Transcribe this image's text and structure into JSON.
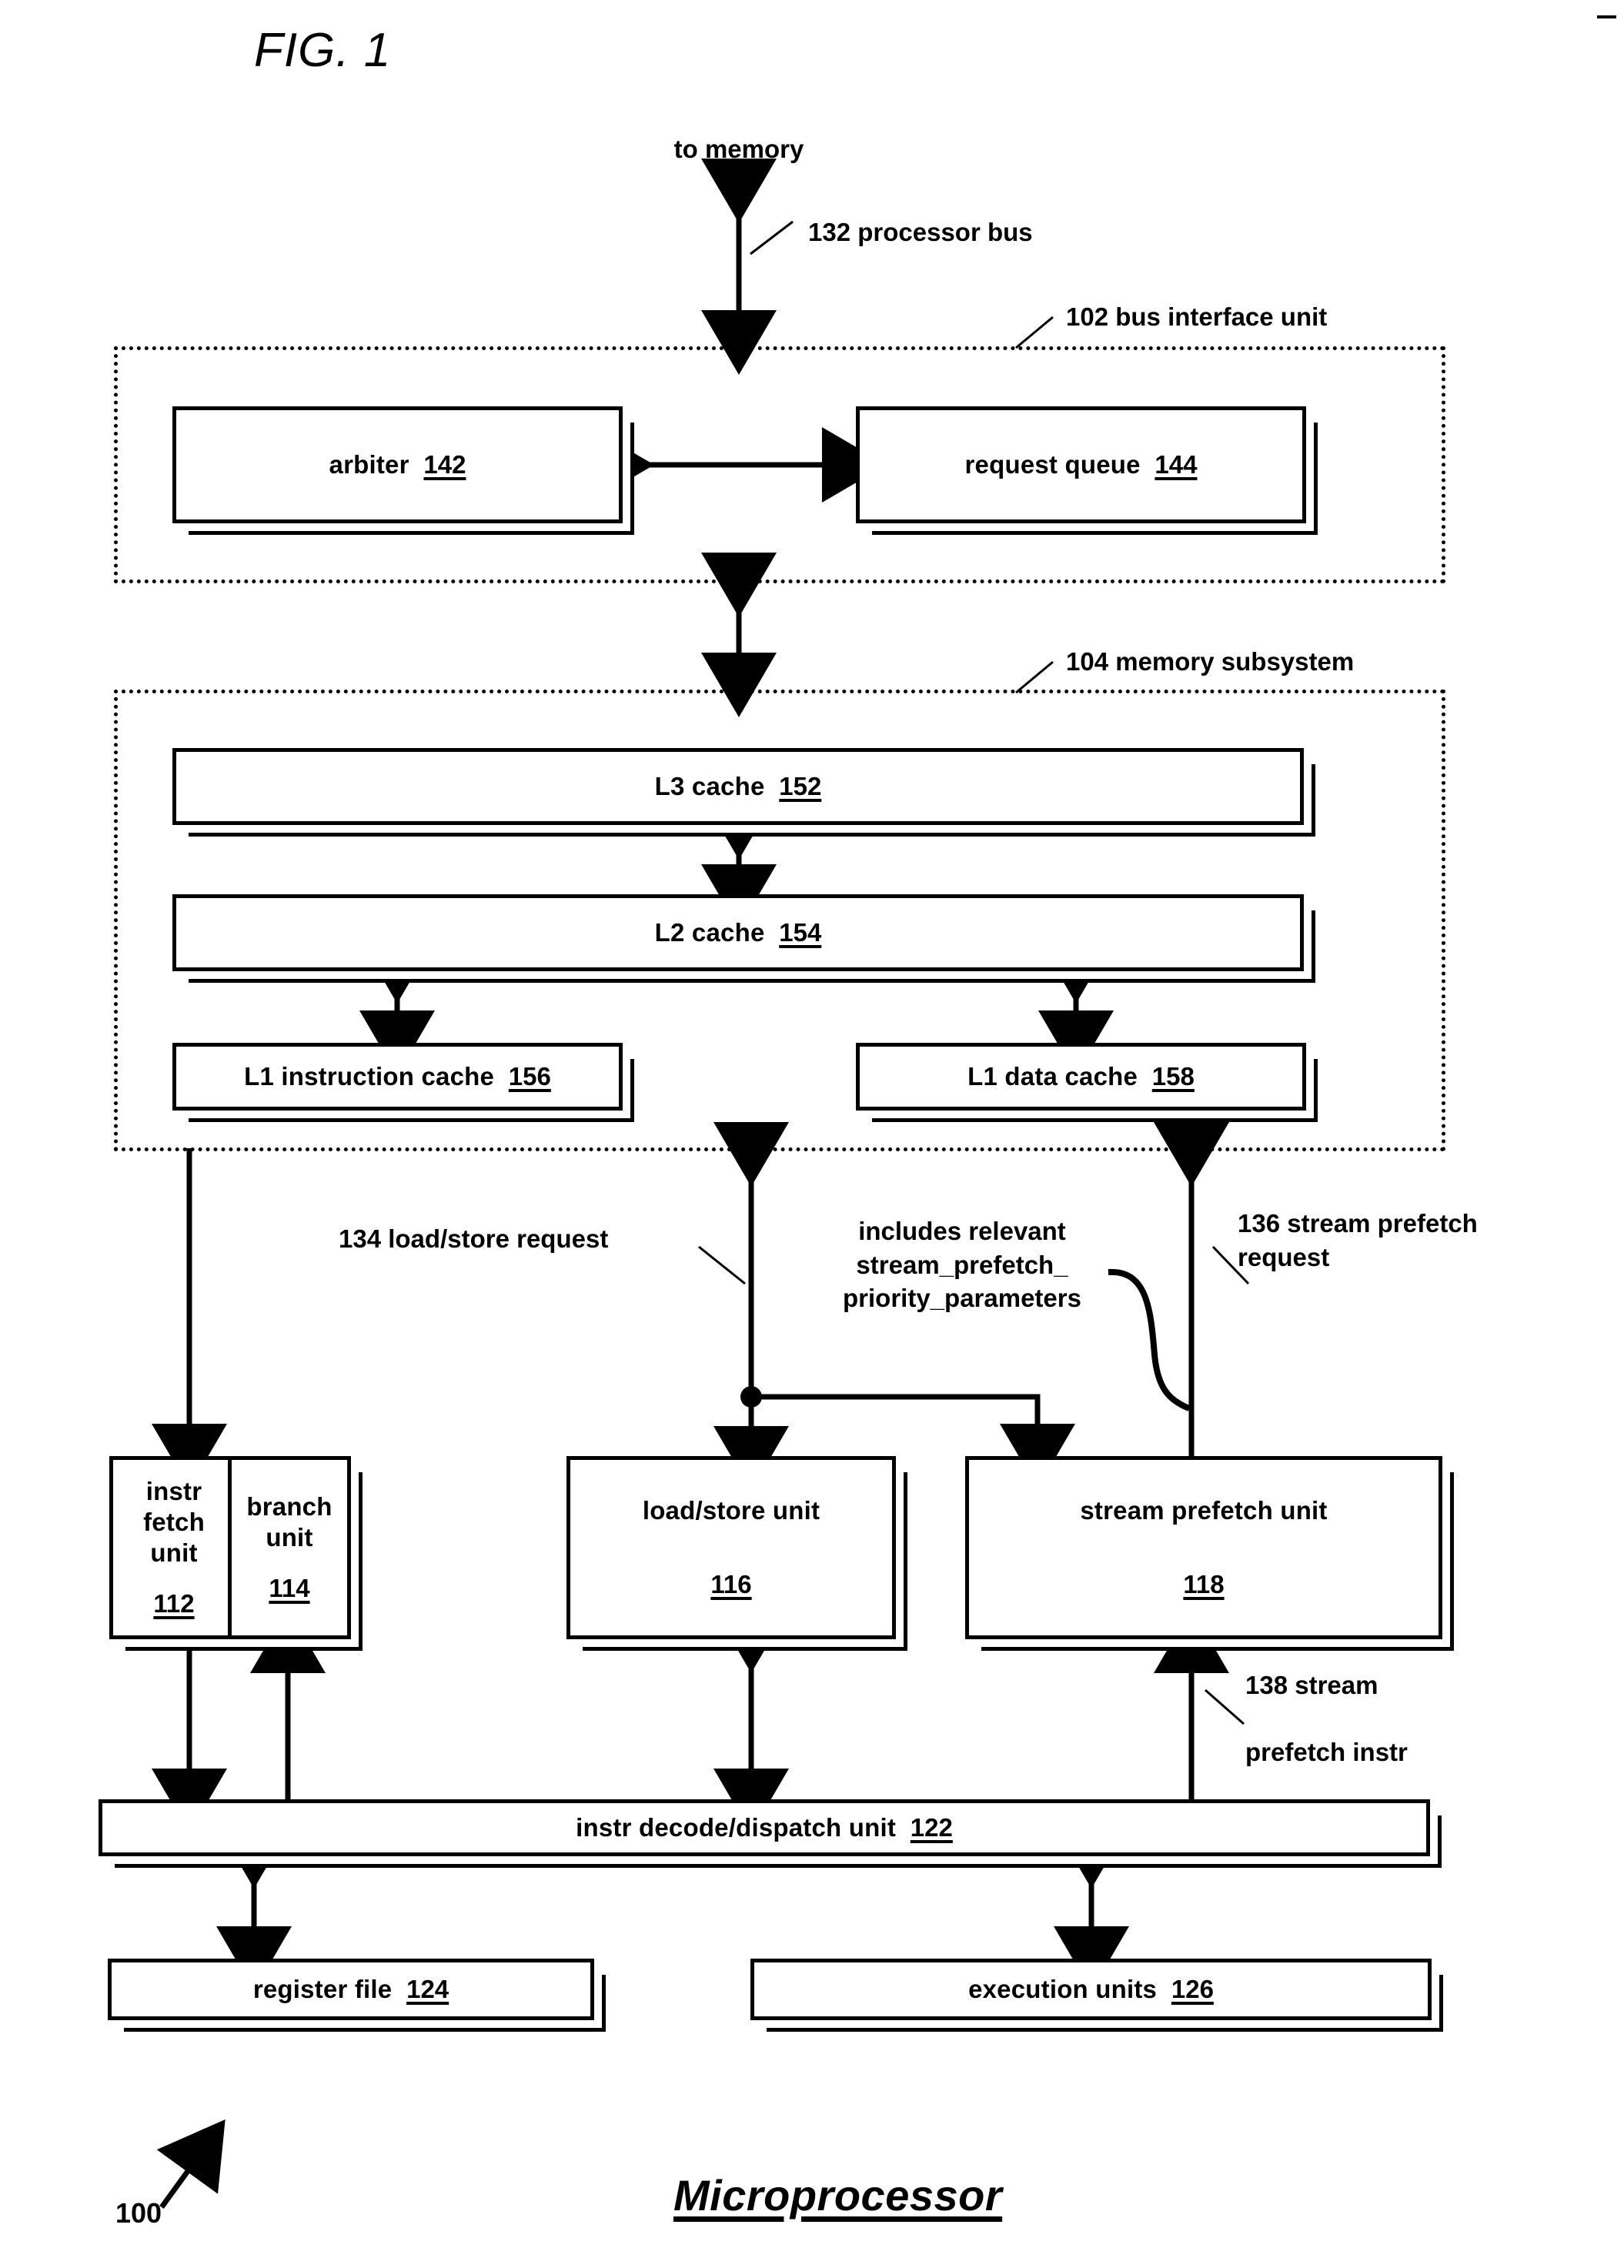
{
  "figure": {
    "label": "FIG. 1",
    "title": "Microprocessor",
    "ref_number": "100"
  },
  "top": {
    "to_memory": "to memory",
    "processor_bus": "132  processor bus"
  },
  "regions": [
    {
      "id": "bus-interface-unit",
      "label": "102  bus interface unit"
    },
    {
      "id": "memory-subsystem",
      "label": "104  memory subsystem"
    }
  ],
  "bus_interface_unit": {
    "blocks": [
      {
        "id": "arbiter",
        "label": "arbiter",
        "num": "142"
      },
      {
        "id": "request-queue",
        "label": "request queue",
        "num": "144"
      }
    ]
  },
  "memory_subsystem": {
    "blocks": [
      {
        "id": "l3-cache",
        "label": "L3 cache",
        "num": "152"
      },
      {
        "id": "l2-cache",
        "label": "L2 cache",
        "num": "154"
      },
      {
        "id": "l1-instruction-cache",
        "label": "L1 instruction cache",
        "num": "156"
      },
      {
        "id": "l1-data-cache",
        "label": "L1 data cache",
        "num": "158"
      }
    ]
  },
  "annotations": {
    "load_store_request": "134  load/store request",
    "includes_relevant": "includes relevant\nstream_prefetch_\npriority_parameters",
    "stream_prefetch_request": "136  stream prefetch\nrequest",
    "stream_prefetch_instr": "138  stream\n\nprefetch instr"
  },
  "functional_units": [
    {
      "id": "instr-fetch-unit",
      "label": "instr fetch\nunit",
      "num": "112"
    },
    {
      "id": "branch-unit",
      "label": "branch\nunit",
      "num": "114"
    },
    {
      "id": "load-store-unit",
      "label": "load/store unit",
      "num": "116"
    },
    {
      "id": "stream-prefetch-unit",
      "label": "stream prefetch unit",
      "num": "118"
    }
  ],
  "dispatch": {
    "label": "instr decode/dispatch unit",
    "num": "122"
  },
  "bottom_units": [
    {
      "id": "register-file",
      "label": "register file",
      "num": "124"
    },
    {
      "id": "execution-units",
      "label": "execution units",
      "num": "126"
    }
  ],
  "colors": {
    "ink": "#000000",
    "paper": "#ffffff"
  }
}
